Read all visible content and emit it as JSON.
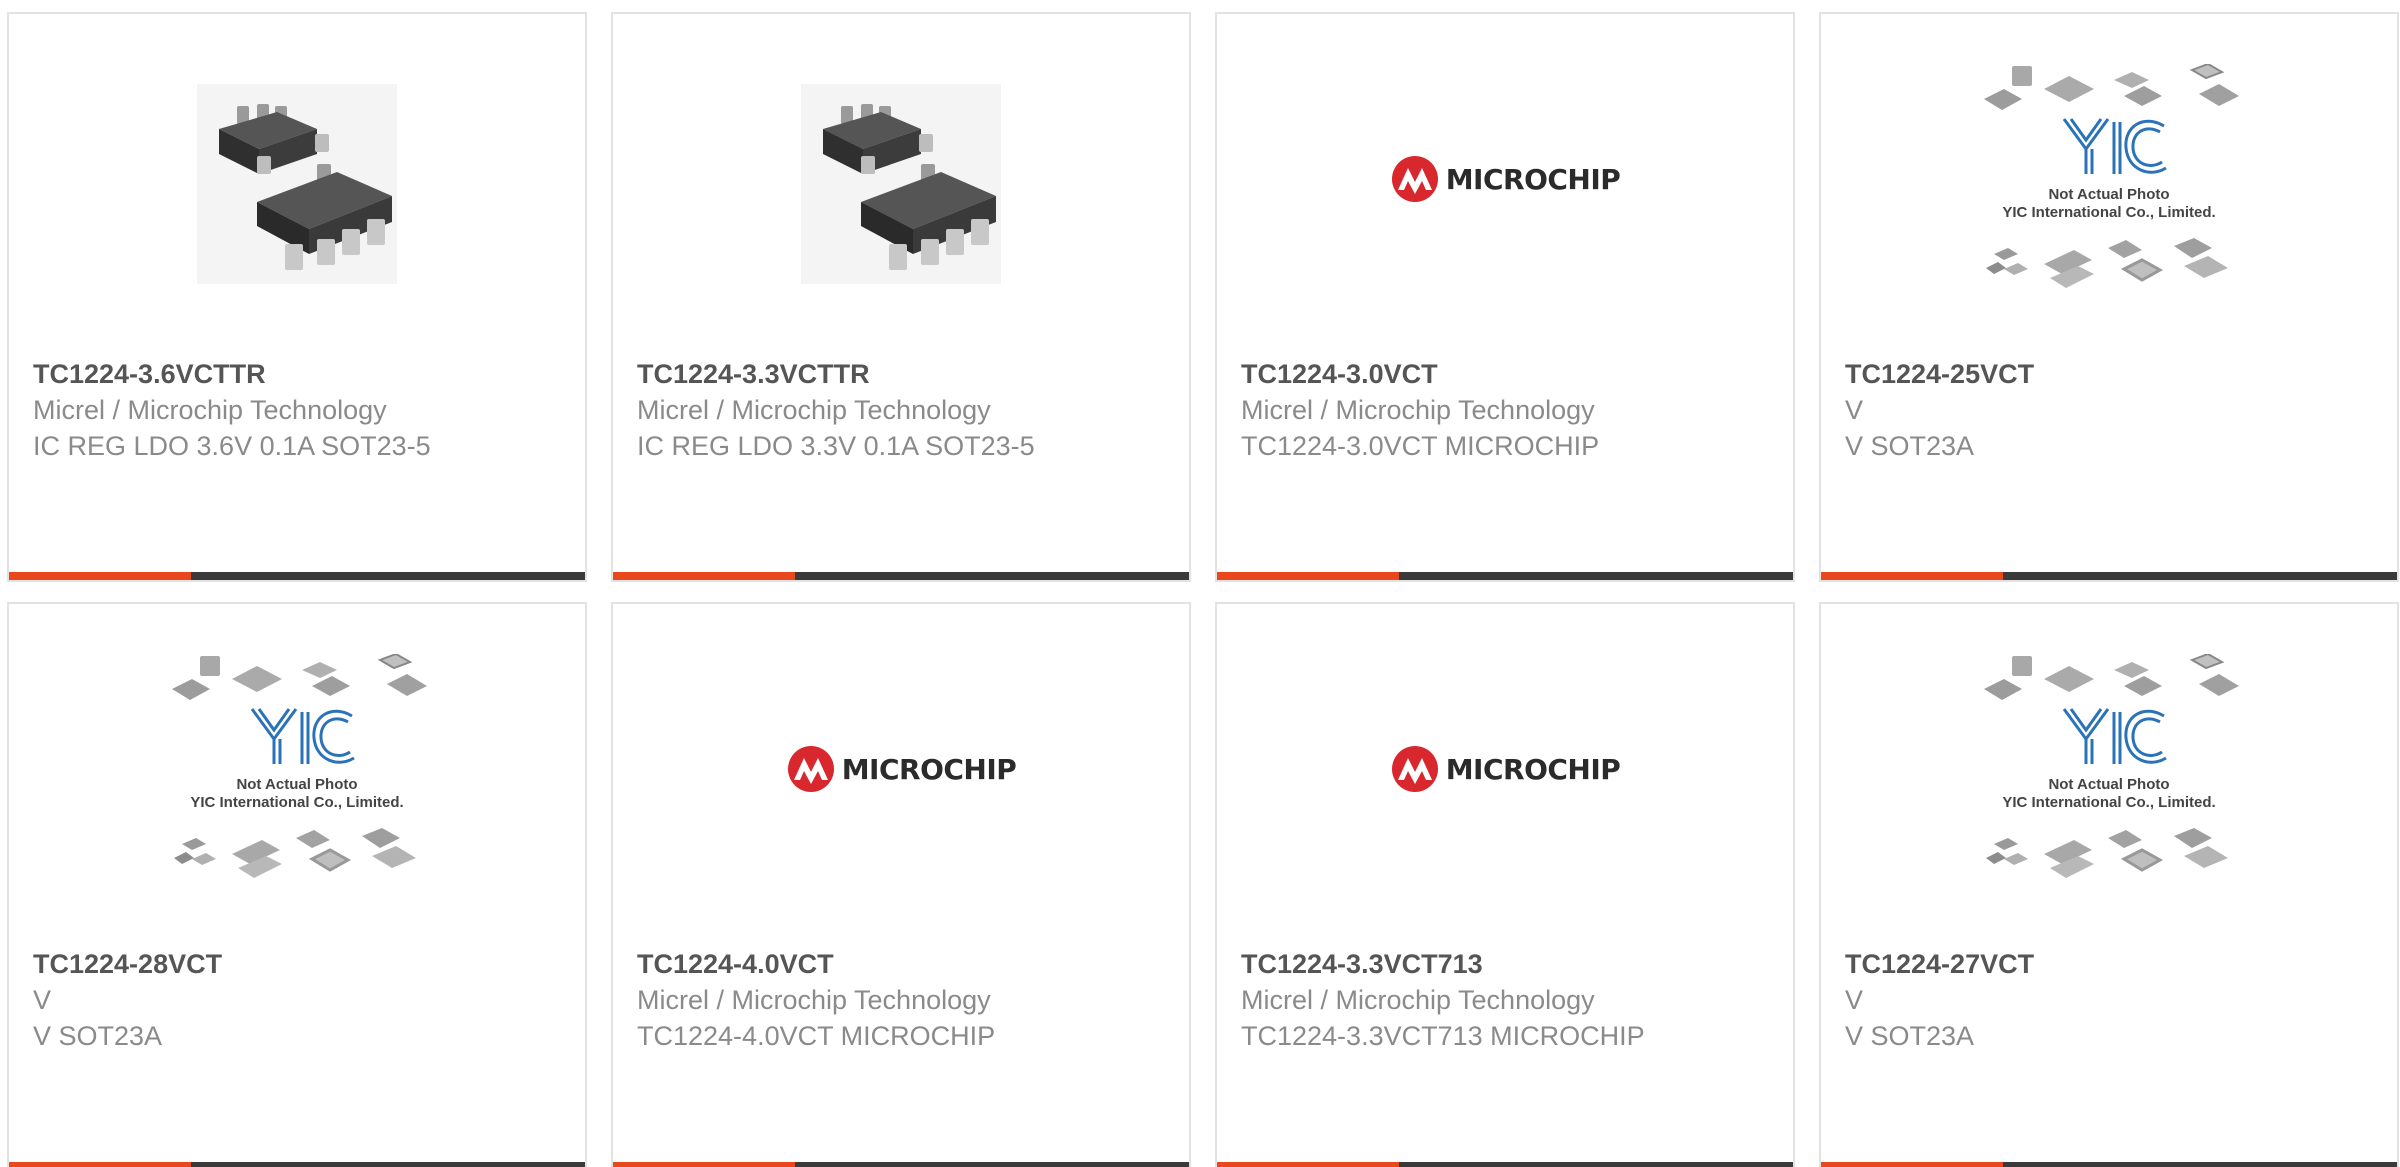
{
  "colors": {
    "accent": "#e8481c",
    "bar": "#3a3a3a",
    "logo_red": "#d9272e",
    "yic_blue": "#2b73b8"
  },
  "products": [
    {
      "image": "sot23-5-photo",
      "part": "TC1224-3.6VCTTR",
      "maker": "Micrel / Microchip Technology",
      "desc": "IC REG LDO 3.6V 0.1A SOT23-5"
    },
    {
      "image": "sot23-5-photo",
      "part": "TC1224-3.3VCTTR",
      "maker": "Micrel / Microchip Technology",
      "desc": "IC REG LDO 3.3V 0.1A SOT23-5"
    },
    {
      "image": "microchip-logo",
      "part": "TC1224-3.0VCT",
      "maker": "Micrel / Microchip Technology",
      "desc": "TC1224-3.0VCT MICROCHIP"
    },
    {
      "image": "not-actual-photo",
      "part": "TC1224-25VCT",
      "maker": "V",
      "desc": "V SOT23A"
    },
    {
      "image": "not-actual-photo",
      "part": "TC1224-28VCT",
      "maker": "V",
      "desc": "V SOT23A"
    },
    {
      "image": "microchip-logo",
      "part": "TC1224-4.0VCT",
      "maker": "Micrel / Microchip Technology",
      "desc": "TC1224-4.0VCT MICROCHIP"
    },
    {
      "image": "microchip-logo",
      "part": "TC1224-3.3VCT713",
      "maker": "Micrel / Microchip Technology",
      "desc": "TC1224-3.3VCT713 MICROCHIP"
    },
    {
      "image": "not-actual-photo",
      "part": "TC1224-27VCT",
      "maker": "V",
      "desc": "V SOT23A"
    }
  ],
  "logo": {
    "microchip_text": "MICROCHIP"
  },
  "placeholder": {
    "line1": "Not Actual Photo",
    "line2": "YIC International Co., Limited."
  }
}
